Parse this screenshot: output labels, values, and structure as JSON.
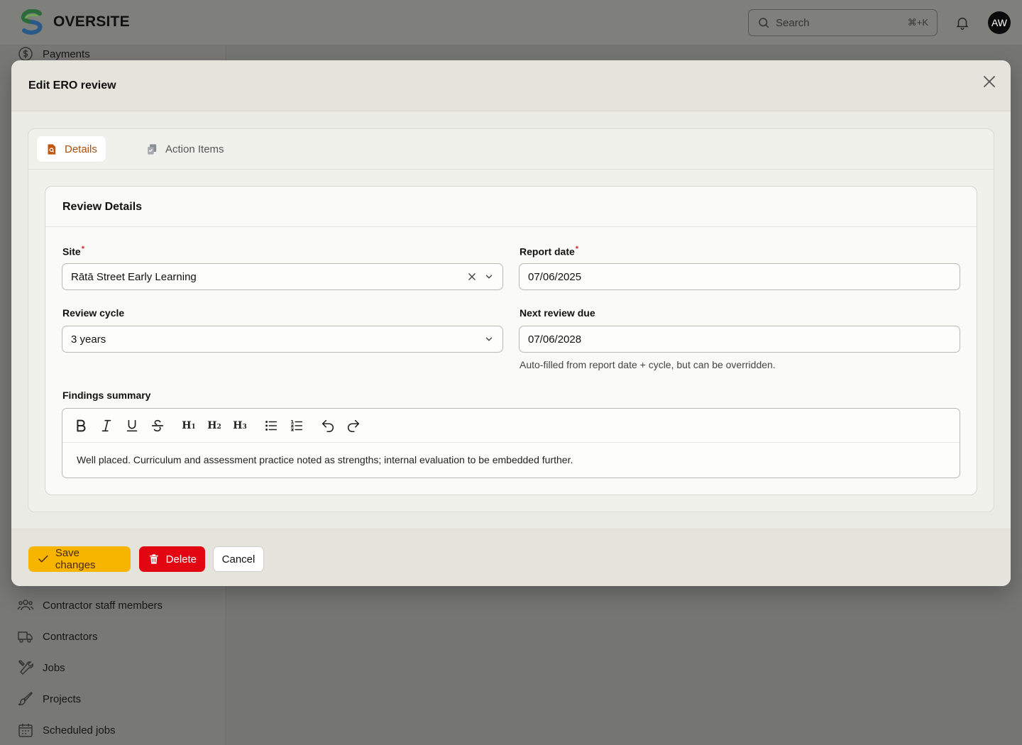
{
  "app": {
    "brand": "OVERSITE",
    "search_placeholder": "Search",
    "search_shortcut": "⌘+K",
    "user_initials": "AW"
  },
  "sidebar": {
    "items": [
      {
        "label": "Payments",
        "icon": "dollar-circle-icon"
      },
      {
        "label": "Contractor staff members",
        "icon": "users-group-icon"
      },
      {
        "label": "Contractors",
        "icon": "truck-icon"
      },
      {
        "label": "Jobs",
        "icon": "wrench-screwdriver-icon"
      },
      {
        "label": "Projects",
        "icon": "paintbrush-icon"
      },
      {
        "label": "Scheduled jobs",
        "icon": "calendar-icon"
      }
    ]
  },
  "modal": {
    "title": "Edit ERO review",
    "tabs": [
      {
        "label": "Details",
        "icon": "document-search-icon",
        "active": true
      },
      {
        "label": "Action Items",
        "icon": "clipboard-check-icon",
        "active": false
      }
    ],
    "section_title": "Review Details",
    "fields": {
      "site": {
        "label": "Site",
        "required": "*",
        "value": "Rātā Street Early Learning"
      },
      "report_date": {
        "label": "Report date",
        "required": "*",
        "value": "07/06/2025"
      },
      "review_cycle": {
        "label": "Review cycle",
        "value": "3 years"
      },
      "next_review_due": {
        "label": "Next review due",
        "value": "07/06/2028",
        "hint": "Auto-filled from report date + cycle, but can be overridden."
      },
      "findings_summary": {
        "label": "Findings summary",
        "value": "Well placed. Curriculum and assessment practice noted as strengths; internal evaluation to be embedded further."
      }
    },
    "editor_toolbar": {
      "h1": "H",
      "h1_sub": "1",
      "h2": "H",
      "h2_sub": "2",
      "h3": "H",
      "h3_sub": "3"
    },
    "footer": {
      "save_label": "Save changes",
      "delete_label": "Delete",
      "cancel_label": "Cancel"
    }
  },
  "colors": {
    "primary": "#f7b500",
    "danger": "#e20612",
    "active_tab": "#b04e07",
    "required": "#e11d2a"
  }
}
